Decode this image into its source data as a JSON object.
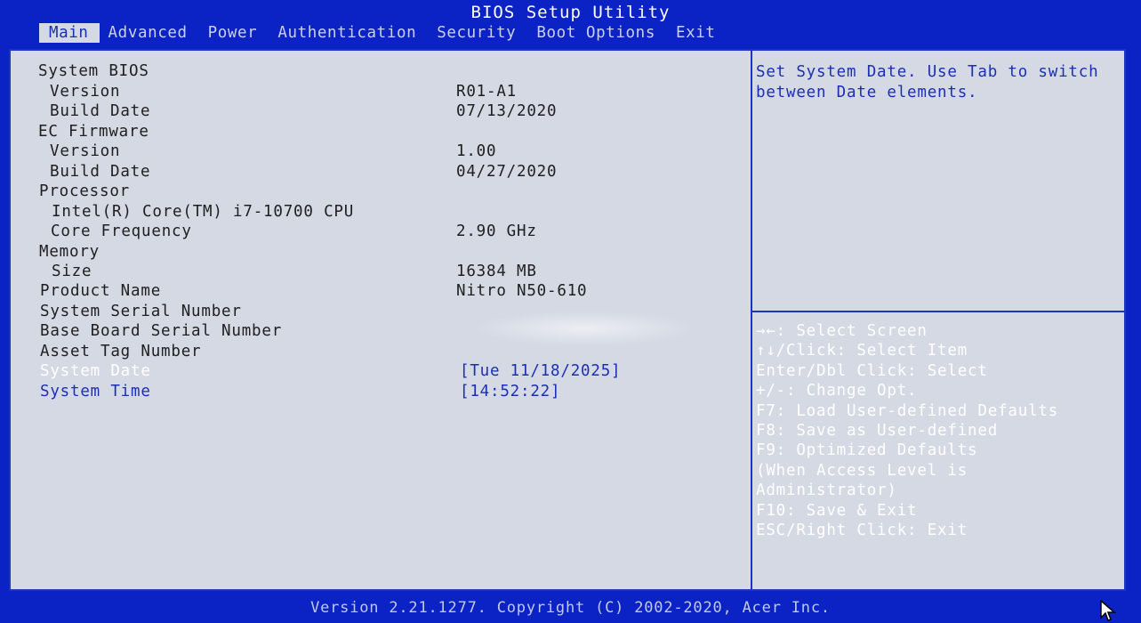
{
  "app": {
    "title": "BIOS Setup Utility",
    "footer": "Version 2.21.1277. Copyright (C) 2002-2020, Acer Inc."
  },
  "tabs": [
    {
      "label": "Main"
    },
    {
      "label": "Advanced"
    },
    {
      "label": "Power"
    },
    {
      "label": "Authentication"
    },
    {
      "label": "Security"
    },
    {
      "label": "Boot Options"
    },
    {
      "label": "Exit"
    }
  ],
  "main": {
    "system_bios_heading": "System BIOS",
    "bios_version_label": "Version",
    "bios_version_value": "R01-A1",
    "bios_build_date_label": "Build Date",
    "bios_build_date_value": "07/13/2020",
    "ec_firmware_heading": "EC Firmware",
    "ec_version_label": "Version",
    "ec_version_value": "1.00",
    "ec_build_date_label": "Build Date",
    "ec_build_date_value": "04/27/2020",
    "processor_heading": "Processor",
    "processor_name": "Intel(R) Core(TM) i7-10700 CPU",
    "core_frequency_label": "Core Frequency",
    "core_frequency_value": "2.90 GHz",
    "memory_heading": "Memory",
    "memory_size_label": "Size",
    "memory_size_value": "16384 MB",
    "product_name_label": "Product Name",
    "product_name_value": "Nitro N50-610",
    "system_serial_label": "System Serial Number",
    "base_board_serial_label": "Base Board Serial Number",
    "asset_tag_label": "Asset Tag Number",
    "system_date_label": "System Date",
    "system_date_value": "[Tue 11/18/2025]",
    "system_time_label": "System Time",
    "system_time_value": "[14:52:22]"
  },
  "help": {
    "description": "Set System Date. Use Tab to switch between Date elements.",
    "keys": [
      "→←: Select Screen",
      "↑↓/Click: Select Item",
      "Enter/Dbl Click: Select",
      "+/-: Change Opt.",
      "F7: Load User-defined Defaults",
      "F8: Save as User-defined",
      "F9: Optimized Defaults",
      "(When Access Level is",
      "Administrator)",
      "F10: Save & Exit",
      "ESC/Right Click: Exit"
    ]
  },
  "colors": {
    "background": "#0b22c4",
    "panel": "#d4d9e4",
    "highlight_text": "#ffffff",
    "selectable_text": "#1c2fb4"
  },
  "icons": {
    "cursor": "mouse-pointer-icon"
  }
}
